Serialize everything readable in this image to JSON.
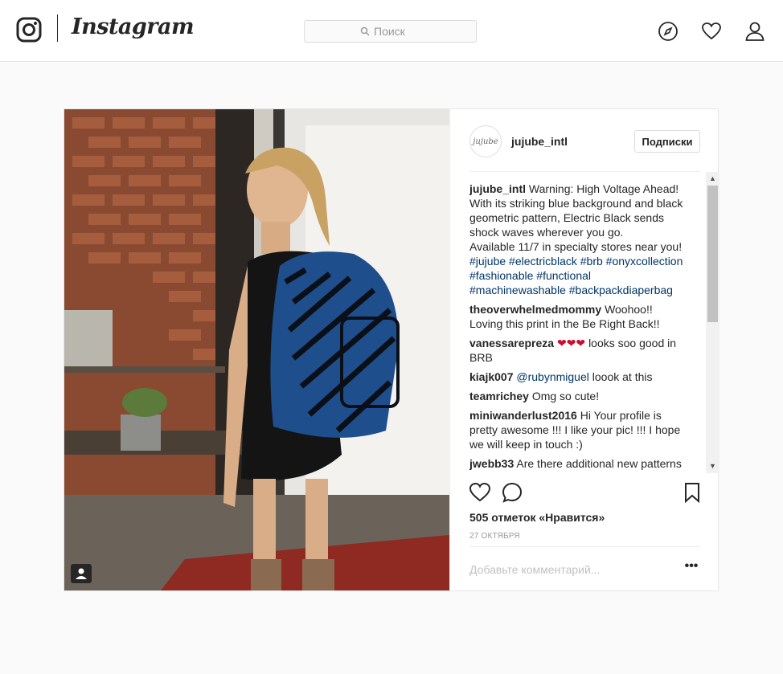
{
  "nav": {
    "wordmark": "Instagram",
    "search_placeholder": "Поиск"
  },
  "post": {
    "username": "jujube_intl",
    "avatar_text": "jujube",
    "follow_label": "Подписки",
    "caption": {
      "user": "jujube_intl",
      "text": "Warning: High Voltage Ahead! With its striking blue background and black geometric pattern, Electric Black sends shock waves wherever you go.",
      "text2": "Available 11/7 in specialty stores near you!",
      "tags": "#jujube #electricblack #brb #onyxcollection #fashionable #functional #machinewashable #backpackdiaperbag"
    },
    "comments": [
      {
        "user": "theoverwhelmedmommy",
        "text": "Woohoo!! Loving this print in the Be Right Back!!"
      },
      {
        "user": "vanessarepreza",
        "hearts": "❤❤❤",
        "text": "looks soo good in BRB"
      },
      {
        "user": "kiajk007",
        "mention": "@rubynmiguel",
        "text": "loook at this"
      },
      {
        "user": "teamrichey",
        "text": "Omg so cute!"
      },
      {
        "user": "miniwanderlust2016",
        "text": "Hi Your profile is pretty awesome !!! I like your pic! !!! I hope we will keep in touch :)"
      },
      {
        "user": "jwebb33",
        "text": "Are there additional new patterns"
      }
    ],
    "likes": "505 отметок «Нравится»",
    "date": "27 ОКТЯБРЯ",
    "comment_placeholder": "Добавьте комментарий...",
    "more_label": "•••"
  },
  "colors": {
    "link": "#003569",
    "backpack_blue": "#1f4e8c"
  }
}
